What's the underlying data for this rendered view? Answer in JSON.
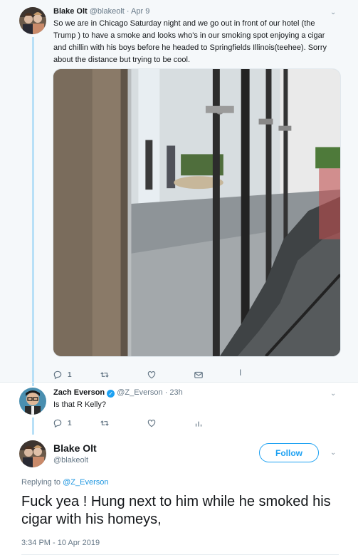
{
  "parent_tweet": {
    "name": "Blake Olt",
    "handle": "@blakeolt",
    "date": "· Apr 9",
    "text": "So we are in Chicago Saturday night and we go out in front of  our hotel (the Trump ) to have a smoke and looks who's in our smoking spot enjoying a cigar and chillin with his boys before he headed to Springfields Illinois(teehee). Sorry about the distance but trying to be cool.",
    "reply_count": "1",
    "actions": {
      "reply": "reply-icon",
      "retweet": "retweet-icon",
      "like": "heart-icon",
      "dm": "envelope-icon"
    }
  },
  "reply_tweet": {
    "name": "Zach Everson",
    "handle": "@Z_Everson",
    "date": "· 23h",
    "text": "Is that R Kelly?",
    "reply_count": "1",
    "actions": {
      "reply": "reply-icon",
      "retweet": "retweet-icon",
      "like": "heart-icon",
      "analytics": "analytics-icon"
    }
  },
  "main_tweet": {
    "name": "Blake Olt",
    "handle": "@blakeolt",
    "follow_label": "Follow",
    "replying_prefix": "Replying to",
    "replying_to": "@Z_Everson",
    "text": "Fuck yea ! Hung next to him while he smoked his cigar with his homeys,",
    "timestamp": "3:34 PM - 10 Apr 2019"
  },
  "colors": {
    "accent": "#1da1f2",
    "verified": "#1da1f2",
    "muted": "#657786",
    "thread_line": "#b8e0f7"
  }
}
